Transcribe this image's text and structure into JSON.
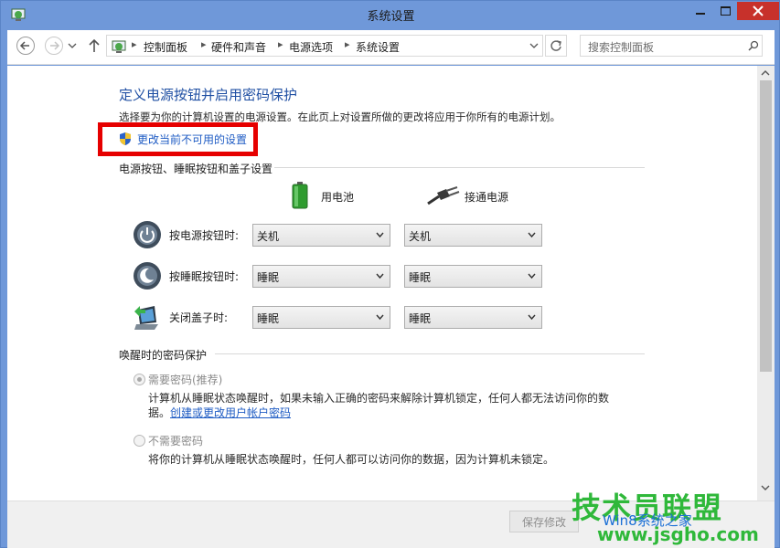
{
  "window": {
    "title": "系统设置"
  },
  "address": {
    "crumbs": [
      "控制面板",
      "硬件和声音",
      "电源选项",
      "系统设置"
    ],
    "search_placeholder": "搜索控制面板"
  },
  "page": {
    "heading": "定义电源按钮并启用密码保护",
    "description": "选择要为你的计算机设置的电源设置。在此页上对设置所做的更改将应用于你所有的电源计划。",
    "change_link": "更改当前不可用的设置",
    "section_buttons": "电源按钮、睡眠按钮和盖子设置",
    "col_battery": "用电池",
    "col_plugged": "接通电源",
    "rows": [
      {
        "label": "按电源按钮时:",
        "battery": "关机",
        "plugged": "关机",
        "icon": "power-button-icon"
      },
      {
        "label": "按睡眠按钮时:",
        "battery": "睡眠",
        "plugged": "睡眠",
        "icon": "sleep-button-icon"
      },
      {
        "label": "关闭盖子时:",
        "battery": "睡眠",
        "plugged": "睡眠",
        "icon": "laptop-lid-icon"
      }
    ],
    "section_password": "唤醒时的密码保护",
    "option_require": "需要密码(推荐)",
    "option_require_note_1": "计算机从睡眠状态唤醒时，如果未输入正确的密码来解除计算机锁定，任何人都无法访问你的数",
    "option_require_note_2": "据。",
    "account_link": "创建或更改用户帐户密码",
    "option_none": "不需要密码",
    "option_none_note": "将你的计算机从睡眠状态唤醒时，任何人都可以访问你的数据，因为计算机未锁定。"
  },
  "footer": {
    "save_label": "保存修改"
  },
  "watermark": {
    "title": "技术员联盟",
    "sub": "Win8系统之家",
    "url": "www.jsgho.com"
  },
  "colors": {
    "accent_link": "#1f5cc4",
    "heading": "#1f4fa3",
    "highlight_box": "#e60000",
    "close_button": "#c7312b",
    "window_frame": "#6f98d9"
  }
}
